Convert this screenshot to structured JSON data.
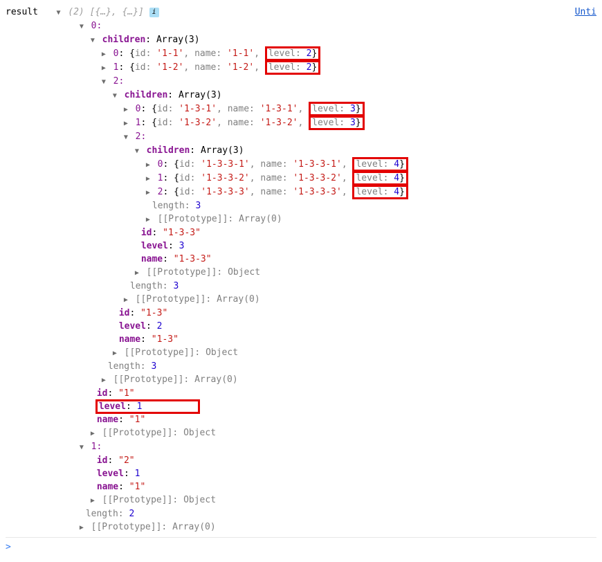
{
  "header": {
    "result_label": "result",
    "summary": "(2) [{…}, {…}]",
    "unt": "Unti"
  },
  "root": {
    "idx0_label": "0:",
    "children_label": "children",
    "array3": "Array(3)",
    "array0": "Array(0)",
    "proto_label": "[[Prototype]]",
    "object_label": "Object",
    "length_label": "length",
    "id_label": "id",
    "name_label": "name",
    "level_label": "level"
  },
  "row_0_0": {
    "idx": "0",
    "id": "'1-1'",
    "name": "'1-1'",
    "level": "2"
  },
  "row_0_1": {
    "idx": "1",
    "id": "'1-2'",
    "name": "'1-2'",
    "level": "2"
  },
  "row_0_2_idx": "2:",
  "row_0_2_0": {
    "idx": "0",
    "id": "'1-3-1'",
    "name": "'1-3-1'",
    "level": "3"
  },
  "row_0_2_1": {
    "idx": "1",
    "id": "'1-3-2'",
    "name": "'1-3-2'",
    "level": "3"
  },
  "row_0_2_2_idx": "2:",
  "row_0_2_2_0": {
    "idx": "0",
    "id": "'1-3-3-1'",
    "name": "'1-3-3-1'",
    "level": "4"
  },
  "row_0_2_2_1": {
    "idx": "1",
    "id": "'1-3-3-2'",
    "name": "'1-3-3-2'",
    "level": "4"
  },
  "row_0_2_2_2": {
    "idx": "2",
    "id": "'1-3-3-3'",
    "name": "'1-3-3-3'",
    "level": "4"
  },
  "obj_0_2_2": {
    "length": "3",
    "id": "\"1-3-3\"",
    "level": "3",
    "name": "\"1-3-3\""
  },
  "obj_0_2": {
    "length": "3",
    "id": "\"1-3\"",
    "level": "2",
    "name": "\"1-3\""
  },
  "obj_0": {
    "length": "3",
    "id": "\"1\"",
    "level": "1",
    "name": "\"1\""
  },
  "idx1_label": "1:",
  "obj_1": {
    "id": "\"2\"",
    "level": "1",
    "name": "\"1\""
  },
  "tail_length": "2"
}
